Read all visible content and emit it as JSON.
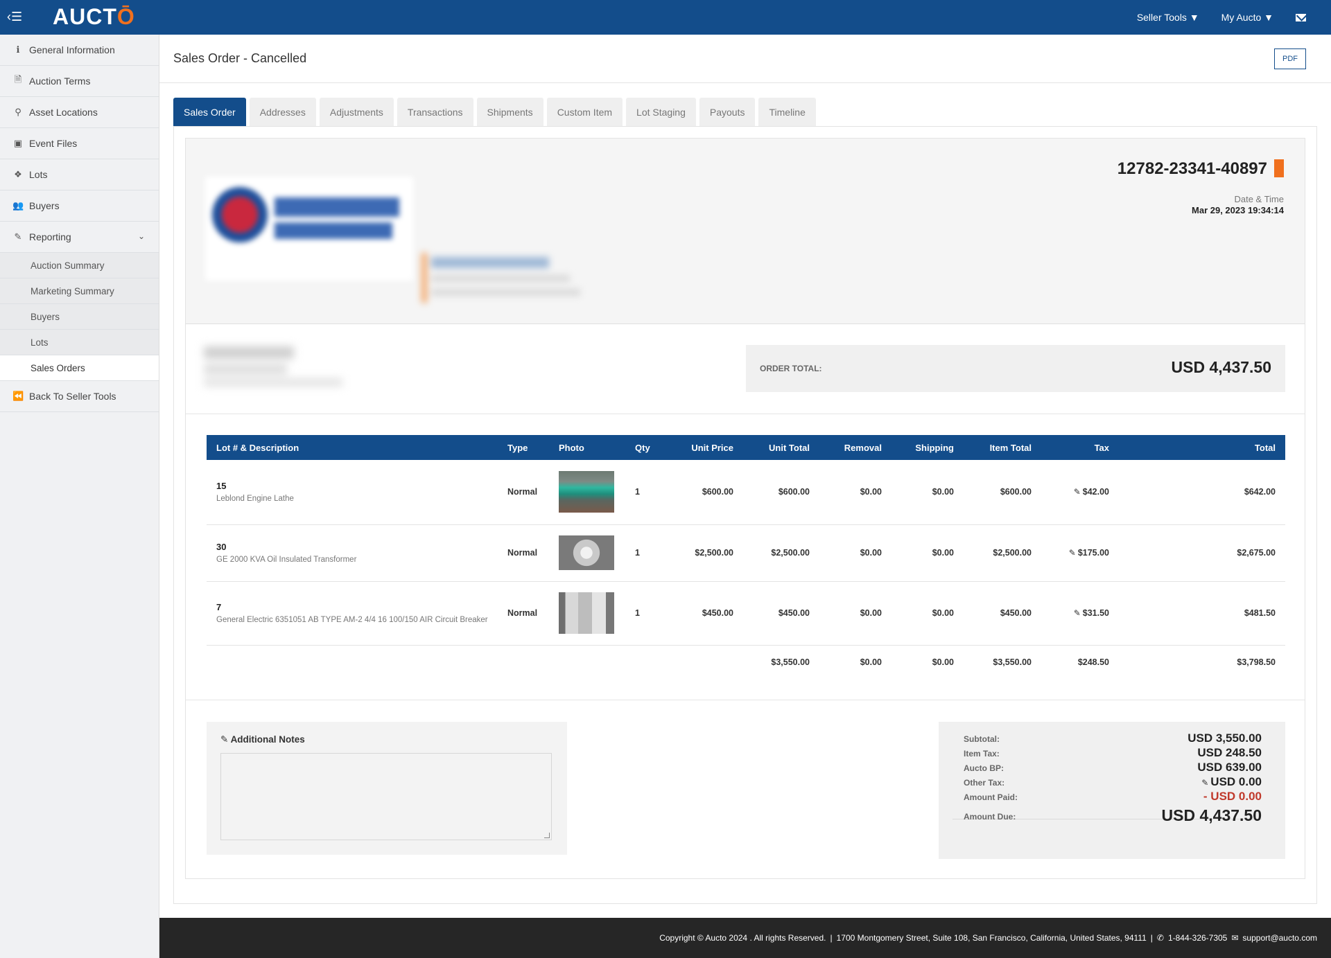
{
  "app": {
    "logo_main": "AUCT",
    "logo_accent": "Ō",
    "menu_glyph": "‹☰"
  },
  "topnav": {
    "seller_tools": "Seller Tools ▼",
    "my_aucto": "My Aucto ▼"
  },
  "sidebar": {
    "items": [
      {
        "icon": "info-icon",
        "glyph": "ℹ",
        "label": "General Information"
      },
      {
        "icon": "document-icon",
        "glyph": "🗎",
        "label": "Auction Terms"
      },
      {
        "icon": "map-pin-icon",
        "glyph": "⚲",
        "label": "Asset Locations"
      },
      {
        "icon": "image-icon",
        "glyph": "▣",
        "label": "Event Files"
      },
      {
        "icon": "cubes-icon",
        "glyph": "❖",
        "label": "Lots"
      },
      {
        "icon": "users-icon",
        "glyph": "👥",
        "label": "Buyers"
      },
      {
        "icon": "pencil-icon",
        "glyph": "✎",
        "label": "Reporting"
      }
    ],
    "reporting_sub": [
      "Auction Summary",
      "Marketing Summary",
      "Buyers",
      "Lots",
      "Sales Orders"
    ],
    "back": {
      "icon": "double-left-icon",
      "glyph": "⏪",
      "label": "Back To Seller Tools"
    },
    "chevron": "⌄"
  },
  "page": {
    "title": "Sales Order - Cancelled",
    "pdf_label": "PDF"
  },
  "tabs": [
    "Sales Order",
    "Addresses",
    "Adjustments",
    "Transactions",
    "Shipments",
    "Custom Item",
    "Lot Staging",
    "Payouts",
    "Timeline"
  ],
  "order": {
    "number": "12782-23341-40897",
    "datetime_label": "Date & Time",
    "datetime": "Mar 29, 2023 19:34:14",
    "total_label": "ORDER TOTAL:",
    "total_value": "USD 4,437.50",
    "status_color": "#f0701e"
  },
  "table": {
    "headers": {
      "lot": "Lot # & Description",
      "type": "Type",
      "photo": "Photo",
      "qty": "Qty",
      "unit_price": "Unit Price",
      "unit_total": "Unit Total",
      "removal": "Removal",
      "shipping": "Shipping",
      "item_total": "Item Total",
      "tax": "Tax",
      "total": "Total"
    },
    "rows": [
      {
        "lot": "15",
        "desc": "Leblond Engine Lathe",
        "type": "Normal",
        "qty": "1",
        "unit_price": "$600.00",
        "unit_total": "$600.00",
        "removal": "$0.00",
        "shipping": "$0.00",
        "item_total": "$600.00",
        "tax": "$42.00",
        "total": "$642.00"
      },
      {
        "lot": "30",
        "desc": "GE 2000 KVA Oil Insulated Transformer",
        "type": "Normal",
        "qty": "1",
        "unit_price": "$2,500.00",
        "unit_total": "$2,500.00",
        "removal": "$0.00",
        "shipping": "$0.00",
        "item_total": "$2,500.00",
        "tax": "$175.00",
        "total": "$2,675.00"
      },
      {
        "lot": "7",
        "desc": "General Electric 6351051 AB TYPE AM-2 4/4 16 100/150 AIR Circuit Breaker",
        "type": "Normal",
        "qty": "1",
        "unit_price": "$450.00",
        "unit_total": "$450.00",
        "removal": "$0.00",
        "shipping": "$0.00",
        "item_total": "$450.00",
        "tax": "$31.50",
        "total": "$481.50"
      }
    ],
    "totals": {
      "unit_total": "$3,550.00",
      "removal": "$0.00",
      "shipping": "$0.00",
      "item_total": "$3,550.00",
      "tax": "$248.50",
      "total": "$3,798.50"
    }
  },
  "notes": {
    "title": "Additional Notes",
    "value": ""
  },
  "summary": {
    "subtotal_label": "Subtotal:",
    "subtotal": "USD 3,550.00",
    "item_tax_label": "Item Tax:",
    "item_tax": "USD 248.50",
    "bp_label": "Aucto BP:",
    "bp": "USD 639.00",
    "other_tax_label": "Other Tax:",
    "other_tax": "USD 0.00",
    "paid_label": "Amount Paid:",
    "paid": "- USD 0.00",
    "due_label": "Amount Due:",
    "due": "USD 4,437.50"
  },
  "footer": {
    "copyright": "Copyright © Aucto 2024 . All rights Reserved.",
    "address": "1700 Montgomery Street, Suite 108, San Francisco, California, United States, 94111",
    "phone": "1-844-326-7305",
    "email": "support@aucto.com"
  }
}
